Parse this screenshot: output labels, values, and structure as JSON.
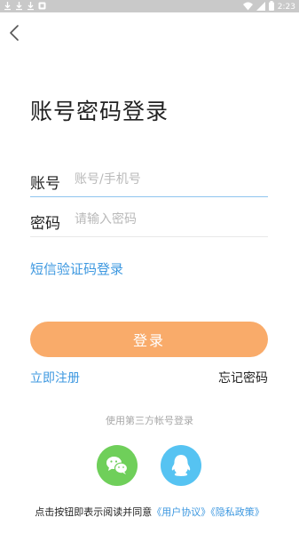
{
  "status_bar": {
    "time": "2:23",
    "icons": [
      "download-icon",
      "download-icon",
      "download-icon",
      "notification-icon",
      "wifi-icon",
      "cellular-icon",
      "battery-icon"
    ]
  },
  "header": {
    "back_icon": "chevron-left-icon"
  },
  "page": {
    "title": "账号密码登录"
  },
  "form": {
    "account_label": "账号",
    "account_placeholder": "账号/手机号",
    "account_value": "",
    "password_label": "密码",
    "password_placeholder": "请输入密码",
    "password_value": ""
  },
  "links": {
    "sms_login": "短信验证码登录",
    "register": "立即注册",
    "forgot_password": "忘记密码"
  },
  "login_button": {
    "label": "登录"
  },
  "third_party": {
    "label": "使用第三方帐号登录",
    "providers": [
      {
        "name_icon": "wechat-icon",
        "color": "#6fcf5a"
      },
      {
        "name_icon": "qq-icon",
        "color": "#56c3f2"
      }
    ]
  },
  "agreement": {
    "prefix": "点击按钮即表示阅读并同意",
    "user_agreement": "《用户协议》",
    "privacy_policy": "《隐私政策》"
  },
  "colors": {
    "accent": "#3d98e0",
    "button": "#f9ab6a",
    "status_bar": "#c9c9c9"
  }
}
